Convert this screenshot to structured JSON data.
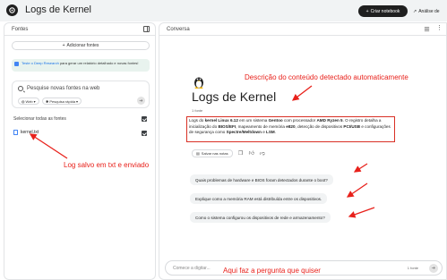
{
  "header": {
    "title": "Logs de Kernel",
    "create_label": "Criar notebook",
    "analysis_label": "Análise de"
  },
  "sources": {
    "title": "Fontes",
    "add_label": "Adicionar fontes",
    "promo_link": "Teste o Deep Research",
    "promo_text": "para gerar um relatório detalhado e novas fontes!",
    "search_placeholder": "Pesquise novas fontes na web",
    "chip_web": "Web",
    "chip_fast": "Pesquisa rápida",
    "select_all": "Selecionar todas as fontes",
    "files": [
      {
        "name": "kernel.txt"
      }
    ]
  },
  "chat": {
    "title": "Conversa",
    "notebook_title": "Logs de Kernel",
    "source_count": "1 fonte",
    "summary": {
      "p1": "Logs do ",
      "b1": "kernel Linux 6.12",
      "p2": " em um sistema ",
      "b2": "Gentoo",
      "p3": " com processador ",
      "b3": "AMD Ryzen 5",
      "p4": ". O registro detalha a inicialização do ",
      "b4": "BIOS/EFI",
      "p5": ", mapeamento de memória ",
      "b5": "e820",
      "p6": ", detecção de dispositivos ",
      "b6": "PCI/USB",
      "p7": " e configurações de segurança como ",
      "b7": "Spectre/Meltdown",
      "p8": " e ",
      "b8": "LSM",
      "p9": "."
    },
    "save_note_label": "Salvar nas notas",
    "suggestions": [
      "Quais problemas de hardware e BIOS foram detectados durante o boot?",
      "Explique como a memória RAM está distribuída entre os dispositivos.",
      "Como o sistema configurou os dispositivos de rede e armazenamento?"
    ],
    "input_placeholder": "Comece a digitar...",
    "input_source_count": "1 fonte"
  },
  "annotations": {
    "description": "Descrição do conteúdo detectado automaticamente",
    "log_saved": "Log salvo em txt e enviado",
    "ask_here": "Aqui faz a pergunta que quiser",
    "color": "#e8211b"
  },
  "icons": [
    "logo-icon",
    "plus-icon",
    "collapse-panel-icon",
    "search-icon",
    "globe-icon",
    "bolt-icon",
    "arrow-right-icon",
    "file-icon",
    "checkbox-icon",
    "grid-icon",
    "more-vert-icon",
    "penguin-icon",
    "note-icon",
    "copy-icon",
    "thumb-up-icon",
    "thumb-down-icon",
    "send-icon"
  ]
}
